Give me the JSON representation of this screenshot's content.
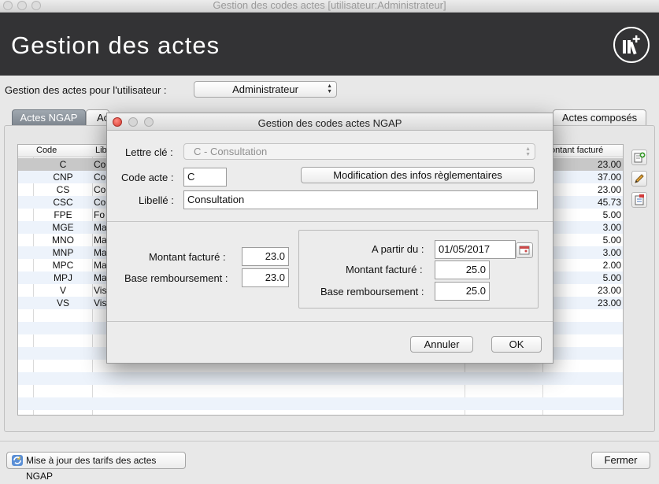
{
  "window": {
    "title": "Gestion des codes actes  [utilisateur:Administrateur]"
  },
  "header": {
    "title": "Gestion des actes",
    "logo_icon": "books-plus-icon"
  },
  "user_row": {
    "label": "Gestion des actes pour l'utilisateur :",
    "selected_user": "Administrateur"
  },
  "tabs": [
    {
      "label": "Actes NGAP",
      "active": true
    },
    {
      "label": "Ac",
      "active": false
    },
    {
      "label": "Actes composés",
      "active": false
    }
  ],
  "table": {
    "columns": [
      "Code",
      "Lib",
      "",
      "ontant facturé"
    ],
    "rows": [
      {
        "code": "C",
        "lib": "Co",
        "amount": "23.00"
      },
      {
        "code": "CNP",
        "lib": "Co",
        "amount": "37.00"
      },
      {
        "code": "CS",
        "lib": "Co",
        "amount": "23.00"
      },
      {
        "code": "CSC",
        "lib": "Co",
        "amount": "45.73"
      },
      {
        "code": "FPE",
        "lib": "Fo",
        "amount": "5.00"
      },
      {
        "code": "MGE",
        "lib": "Ma",
        "amount": "3.00"
      },
      {
        "code": "MNO",
        "lib": "Ma",
        "amount": "5.00"
      },
      {
        "code": "MNP",
        "lib": "Ma",
        "amount": "3.00"
      },
      {
        "code": "MPC",
        "lib": "Ma",
        "amount": "2.00"
      },
      {
        "code": "MPJ",
        "lib": "Ma",
        "amount": "5.00"
      },
      {
        "code": "V",
        "lib": "Vis",
        "amount": "23.00"
      },
      {
        "code": "VS",
        "lib": "Vis",
        "amount": "23.00"
      }
    ]
  },
  "side_buttons": [
    "add-icon",
    "edit-icon",
    "delete-icon"
  ],
  "bottom": {
    "update_label": "Mise à jour des tarifs des actes NGAP",
    "close_label": "Fermer"
  },
  "dialog": {
    "title": "Gestion des codes actes NGAP",
    "lettre_cle_label": "Lettre clé :",
    "lettre_cle_value": "C - Consultation",
    "code_label": "Code acte :",
    "code_value": "C",
    "modif_button": "Modification des infos règlementaires",
    "libelle_label": "Libellé :",
    "libelle_value": "Consultation",
    "montant_label": "Montant facturé :",
    "montant_value": "23.0",
    "base_label": "Base remboursement :",
    "base_value": "23.0",
    "apartir_label": "A partir du :",
    "apartir_value": "01/05/2017",
    "new_montant_label": "Montant facturé :",
    "new_montant_value": "25.0",
    "new_base_label": "Base remboursement :",
    "new_base_value": "25.0",
    "cancel_label": "Annuler",
    "ok_label": "OK"
  }
}
